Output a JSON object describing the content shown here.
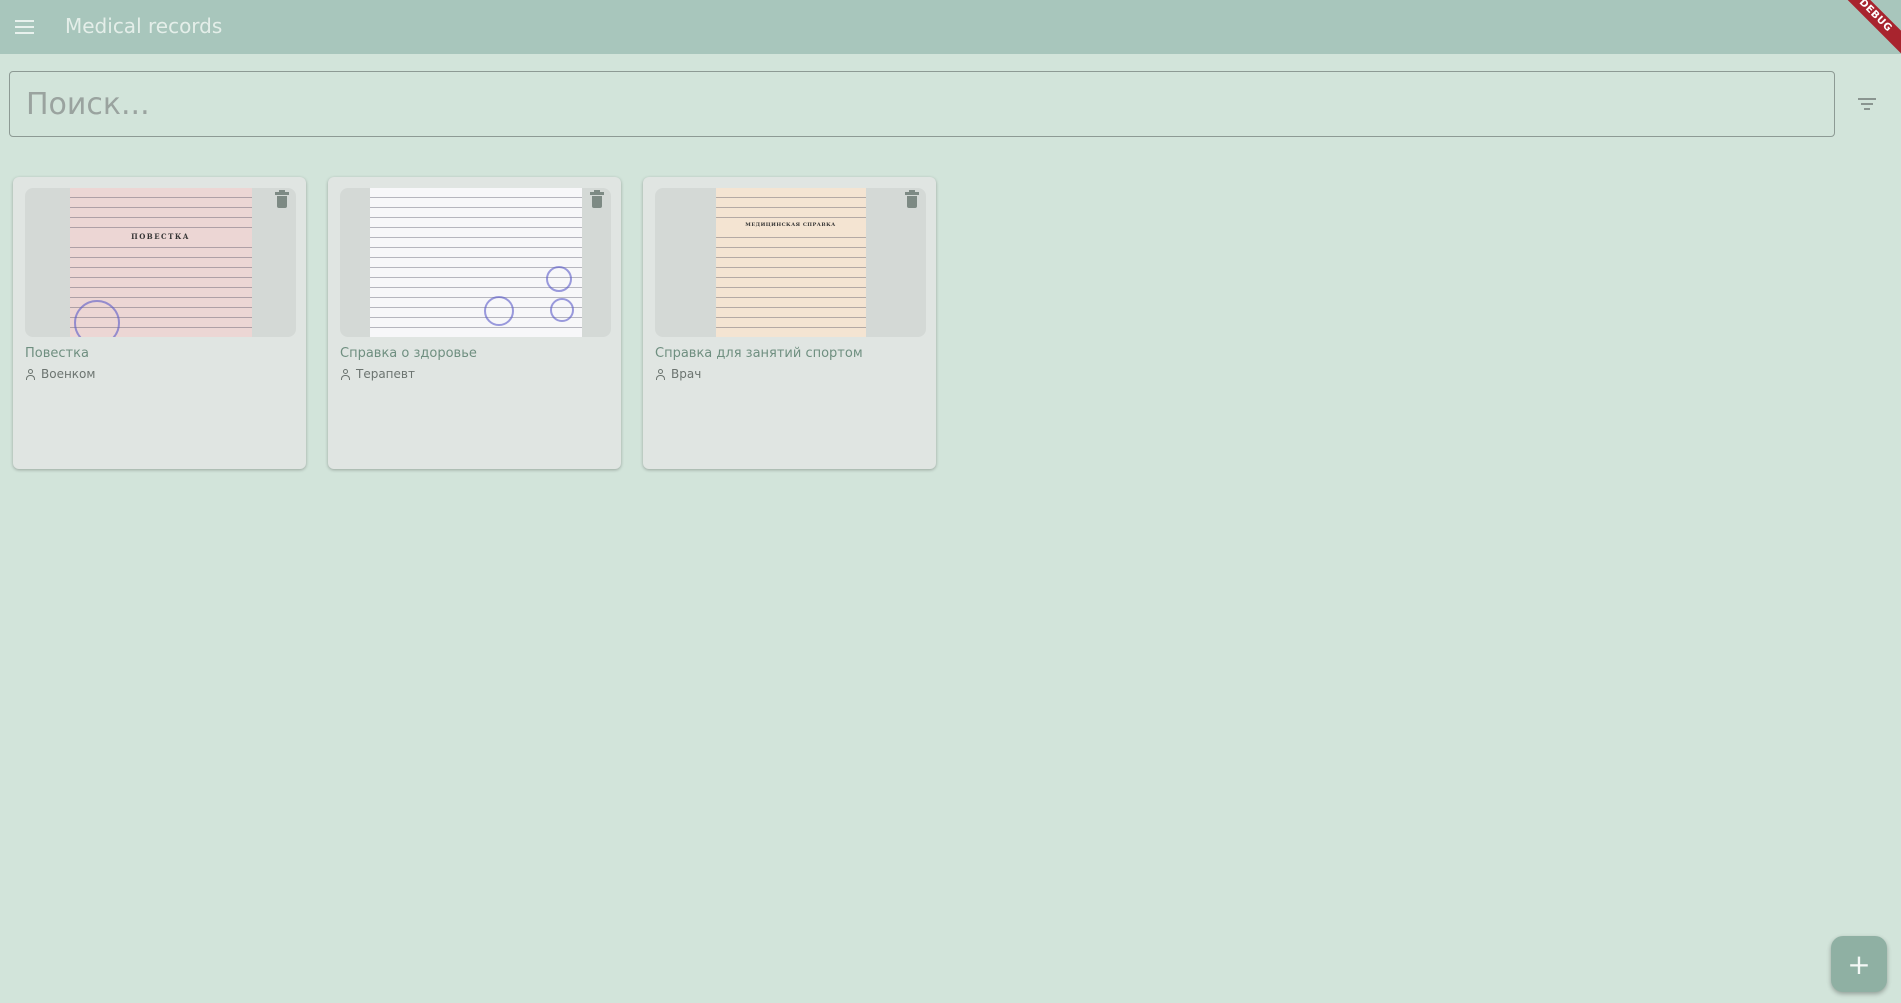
{
  "appbar": {
    "title": "Medical records",
    "debug_label": "DEBUG",
    "menu_icon": "menu-icon"
  },
  "search": {
    "placeholder": "Поиск...",
    "value": "",
    "filter_icon": "filter-icon"
  },
  "records": [
    {
      "title": "Повестка",
      "author": "Военком",
      "thumbnail": "document-scan-pink",
      "doc_heading": "ПОВЕСТКА"
    },
    {
      "title": "Справка о здоровье",
      "author": "Терапевт",
      "thumbnail": "document-scan-white",
      "doc_heading": ""
    },
    {
      "title": "Справка для занятий спортом",
      "author": "Врач",
      "thumbnail": "document-scan-cream",
      "doc_heading": "МЕДИЦИНСКАЯ СПРАВКА"
    }
  ],
  "fab": {
    "label": "+",
    "icon": "add-icon"
  },
  "colors": {
    "background": "#d2e4da",
    "appbar": "#a8c6bc",
    "card": "#e0e5e2",
    "fab": "#8fb0a3",
    "title_accent": "#6f8f80",
    "debug_banner": "#a8242e"
  }
}
